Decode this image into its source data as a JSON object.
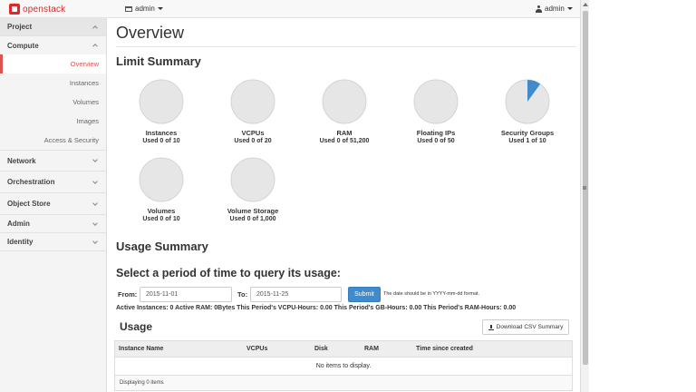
{
  "header": {
    "brand": "openstack",
    "project_menu": "admin",
    "user_menu": "admin"
  },
  "sidebar": {
    "categories": [
      {
        "label": "Project",
        "expanded": true
      },
      {
        "label": "Network"
      },
      {
        "label": "Orchestration"
      },
      {
        "label": "Object Store"
      },
      {
        "label": "Admin"
      },
      {
        "label": "Identity"
      }
    ],
    "compute": {
      "label": "Compute",
      "items": [
        "Overview",
        "Instances",
        "Volumes",
        "Images",
        "Access & Security"
      ],
      "active": "Overview"
    }
  },
  "main": {
    "title": "Overview",
    "limit_summary_title": "Limit Summary",
    "limits": [
      {
        "label": "Instances",
        "used_text": "Used 0 of 10",
        "used": 0,
        "total": 10
      },
      {
        "label": "VCPUs",
        "used_text": "Used 0 of 20",
        "used": 0,
        "total": 20
      },
      {
        "label": "RAM",
        "used_text": "Used 0 of 51,200",
        "used": 0,
        "total": 51200
      },
      {
        "label": "Floating IPs",
        "used_text": "Used 0 of 50",
        "used": 0,
        "total": 50
      },
      {
        "label": "Security Groups",
        "used_text": "Used 1 of 10",
        "used": 1,
        "total": 10
      },
      {
        "label": "Volumes",
        "used_text": "Used 0 of 10",
        "used": 0,
        "total": 10
      },
      {
        "label": "Volume Storage",
        "used_text": "Used 0 of 1,000",
        "used": 0,
        "total": 1000
      }
    ],
    "usage_summary_title": "Usage Summary",
    "period_title": "Select a period of time to query its usage:",
    "from_label": "From:",
    "from_value": "2015-11-01",
    "to_label": "To:",
    "to_value": "2015-11-25",
    "submit_label": "Submit",
    "date_hint": "The date should be in YYYY-mm-dd format.",
    "stats_line": "Active Instances: 0 Active RAM: 0Bytes This Period's VCPU-Hours: 0.00 This Period's GB-Hours: 0.00 This Period's RAM-Hours: 0.00",
    "usage_title": "Usage",
    "csv_button": "Download CSV Summary",
    "table_columns": [
      "Instance Name",
      "VCPUs",
      "Disk",
      "RAM",
      "Time since created"
    ],
    "empty_message": "No items to display.",
    "footer_text": "Displaying 0 items"
  },
  "colors": {
    "pie_empty": "#e6e6e6",
    "pie_used": "#428bca",
    "brand": "#da2a2a",
    "active_nav": "#d9534f"
  }
}
